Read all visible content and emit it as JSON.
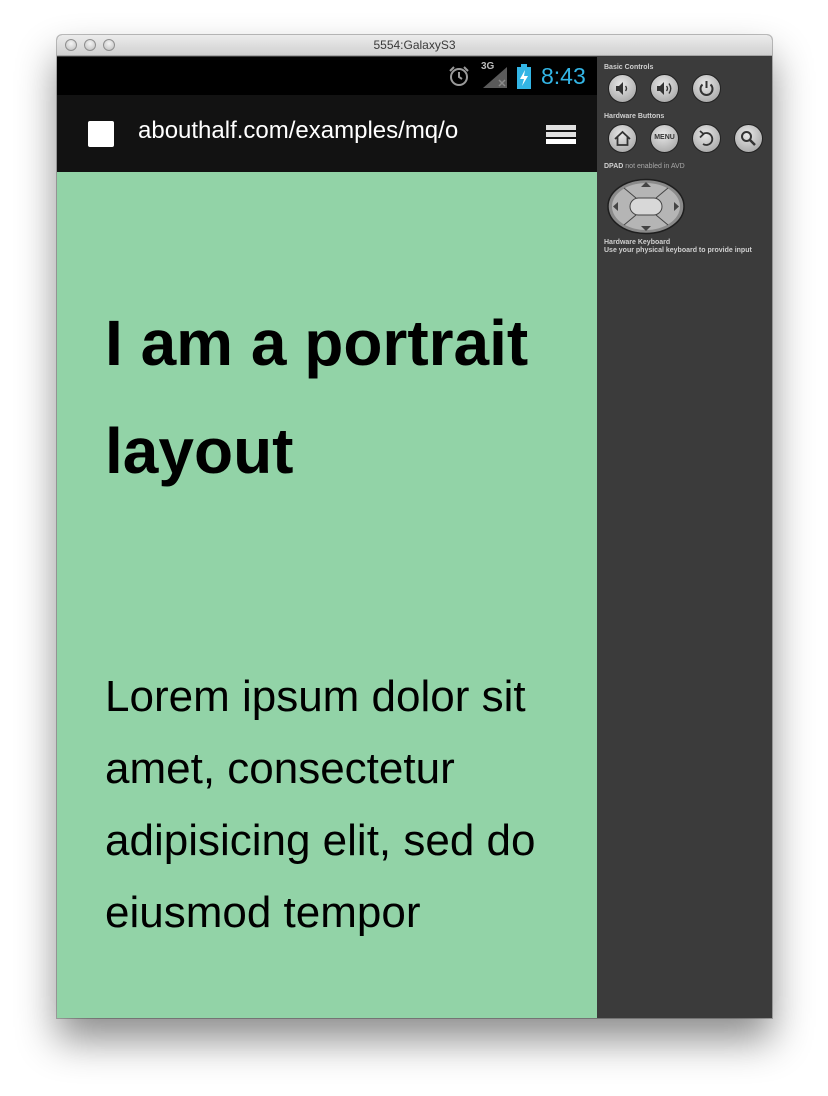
{
  "window": {
    "title": "5554:GalaxyS3"
  },
  "statusbar": {
    "network": "3G",
    "time": "8:43",
    "icons": [
      "alarm-icon",
      "signal-icon",
      "battery-charging-icon"
    ],
    "clock_color": "#33b5e5"
  },
  "browser": {
    "url": "abouthalf.com/examples/mq/o",
    "icons": [
      "favicon-icon",
      "tabs-icon"
    ]
  },
  "page": {
    "heading": "I am a portrait layout",
    "body": "Lorem ipsum dolor sit amet, consectetur adipisicing elit, sed do eiusmod tempor",
    "background": "#92d3a7"
  },
  "controls": {
    "basic_label": "Basic Controls",
    "hardware_label": "Hardware Buttons",
    "menu_label": "MENU",
    "dpad_label": "DPAD",
    "dpad_note": "not enabled in AVD",
    "keyboard_label": "Hardware Keyboard",
    "keyboard_note": "Use your physical keyboard to provide input",
    "icons": [
      "volume-down-icon",
      "volume-up-icon",
      "power-icon",
      "home-icon",
      "menu-button",
      "back-icon",
      "search-icon",
      "dpad-icon"
    ]
  }
}
